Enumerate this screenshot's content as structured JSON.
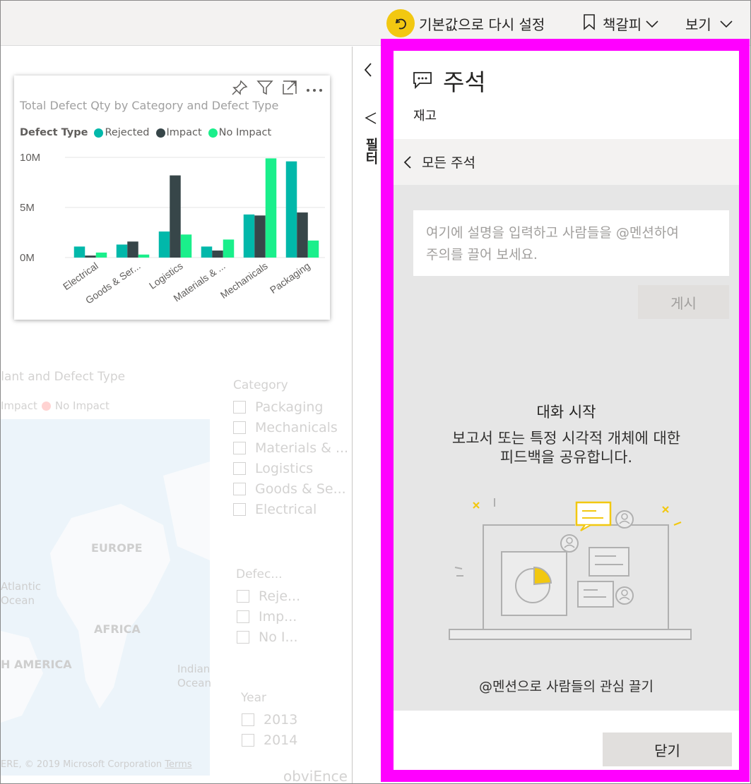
{
  "topbar": {
    "reset_label": "기본값으로 다시 설정",
    "bookmark_label": "책갈피",
    "view_label": "보기"
  },
  "chart": {
    "title": "Total Defect Qty by Category and Defect Type",
    "legend_title": "Defect Type",
    "colors": {
      "rejected": "#01b8aa",
      "impact": "#374649",
      "no_impact": "#1aef8b"
    }
  },
  "chart_data": {
    "type": "bar",
    "title": "Total Defect Qty by Category and Defect Type",
    "legend_title": "Defect Type",
    "categories": [
      "Electrical",
      "Goods & Ser...",
      "Logistics",
      "Materials & ...",
      "Mechanicals",
      "Packaging"
    ],
    "series": [
      {
        "name": "Rejected",
        "values": [
          1.1,
          1.3,
          2.6,
          1.1,
          4.3,
          9.6
        ]
      },
      {
        "name": "Impact",
        "values": [
          0.2,
          1.6,
          8.2,
          0.7,
          4.2,
          4.5
        ]
      },
      {
        "name": "No Impact",
        "values": [
          0.5,
          0.3,
          2.3,
          1.8,
          9.9,
          1.7
        ]
      }
    ],
    "yticks": [
      "0M",
      "5M",
      "10M"
    ],
    "ylim": [
      0,
      10
    ],
    "grid": true,
    "legend_position": "top-left"
  },
  "background": {
    "map_title": "Plant and Defect Type",
    "map_legend": [
      "Impact",
      "No Impact"
    ],
    "map_labels": [
      "EUROPE",
      "Atlantic",
      "Ocean",
      "AFRICA",
      "H AMERICA",
      "Indian",
      "Ocean"
    ],
    "map_copyright": "ERE, © 2019 Microsoft Corporation",
    "map_terms": "Terms",
    "category_title": "Category",
    "category_items": [
      "Packaging",
      "Mechanicals",
      "Materials & ...",
      "Logistics",
      "Goods & Se...",
      "Electrical"
    ],
    "defect_title": "Defec...",
    "defect_items": [
      "Reje...",
      "Imp...",
      "No I..."
    ],
    "year_title": "Year",
    "year_items": [
      "2013",
      "2014"
    ],
    "footer_brand": "obviEnce"
  },
  "filters": {
    "label": "필터"
  },
  "comments_panel": {
    "title": "주석",
    "subtitle": "재고",
    "back_label": "모든 주석",
    "placeholder_line1": "여기에 설명을 입력하고 사람들을 @멘션하여",
    "placeholder_line2": "주의를 끌어 보세요.",
    "post_label": "게시",
    "start_title": "대화 시작",
    "start_desc_line1": "보고서 또는 특정 시각적 개체에 대한",
    "start_desc_line2": "피드백을 공유합니다.",
    "mention_hint": "@멘션으로 사람들의 관심 끌기",
    "close_label": "닫기",
    "highlight_color": "#ff00ff"
  }
}
